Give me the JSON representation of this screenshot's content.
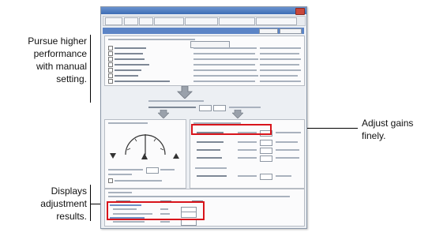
{
  "callouts": {
    "manual_setting": [
      "Pursue higher",
      "performance",
      "with manual",
      "setting."
    ],
    "adjust_gains": [
      "Adjust gains",
      "finely."
    ],
    "adjustment_results": [
      "Displays",
      "adjustment",
      "results."
    ]
  },
  "colors": {
    "highlight": "#d8141b",
    "window_bg": "#eceff3",
    "titlebar": "#4a78bd"
  },
  "icons": [
    "down-arrow-icon",
    "meter-gauge-icon",
    "warning-triangle-icon"
  ]
}
